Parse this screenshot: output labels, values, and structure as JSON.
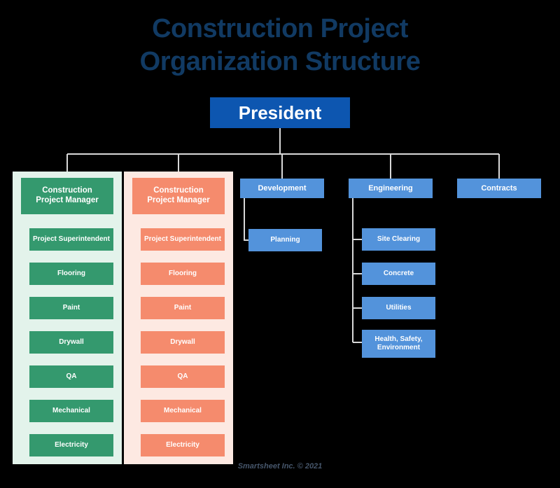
{
  "title": "Construction Project\nOrganization Structure",
  "colors": {
    "background": "#000000",
    "title_text": "#113a63",
    "president": "#0d56b0",
    "green_box": "#34996e",
    "green_panel": "#e3f3eb",
    "pink_box": "#f58b6d",
    "pink_panel": "#fde9e2",
    "blue_box": "#5393db",
    "connector": "#d8d8d8",
    "footer_text": "#46566b"
  },
  "root": {
    "label": "President"
  },
  "columns": {
    "green": {
      "head": "Construction\nProject Manager",
      "children": [
        "Project Superintendent",
        "Flooring",
        "Paint",
        "Drywall",
        "QA",
        "Mechanical",
        "Electricity"
      ]
    },
    "pink": {
      "head": "Construction\nProject Manager",
      "children": [
        "Project Superintendent",
        "Flooring",
        "Paint",
        "Drywall",
        "QA",
        "Mechanical",
        "Electricity"
      ]
    }
  },
  "departments": [
    {
      "label": "Development",
      "children": [
        "Planning"
      ]
    },
    {
      "label": "Engineering",
      "children": [
        "Site Clearing",
        "Concrete",
        "Utilities",
        "Health, Safety,\nEnvironment"
      ]
    },
    {
      "label": "Contracts",
      "children": []
    }
  ],
  "footer": {
    "credit": "Smartsheet Inc. © 2021"
  }
}
